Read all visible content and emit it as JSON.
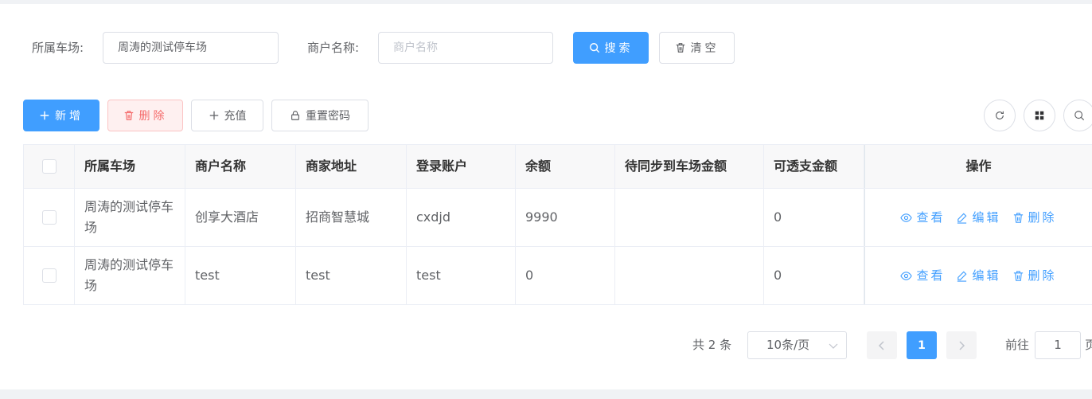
{
  "search": {
    "lot_label": "所属车场:",
    "lot_value": "周涛的测试停车场",
    "merchant_label": "商户名称:",
    "merchant_placeholder": "商户名称",
    "search_button": "搜索",
    "clear_button": "清空"
  },
  "toolbar": {
    "add_button": "新增",
    "delete_button": "删除",
    "recharge_button": "充值",
    "reset_password_button": "重置密码",
    "right_icons": [
      "refresh-icon",
      "grid-icon",
      "search-icon"
    ]
  },
  "table": {
    "columns": [
      "所属车场",
      "商户名称",
      "商家地址",
      "登录账户",
      "余额",
      "待同步到车场金额",
      "可透支金额",
      "操作"
    ],
    "rows": [
      {
        "lot": "周涛的测试停车场",
        "merchant": "创享大酒店",
        "address": "招商智慧城",
        "account": "cxdjd",
        "balance": "9990",
        "pending": "",
        "overdraft": "0"
      },
      {
        "lot": "周涛的测试停车场",
        "merchant": "test",
        "address": "test",
        "account": "test",
        "balance": "0",
        "pending": "",
        "overdraft": "0"
      }
    ],
    "actions": {
      "view": "查看",
      "edit": "编辑",
      "delete": "删除"
    }
  },
  "pagination": {
    "total_text": "共 2 条",
    "page_size": "10条/页",
    "current_page": "1",
    "goto_label": "前往",
    "goto_value": "1",
    "goto_suffix": "页"
  },
  "colors": {
    "primary": "#409eff",
    "danger": "#f56c6c"
  }
}
